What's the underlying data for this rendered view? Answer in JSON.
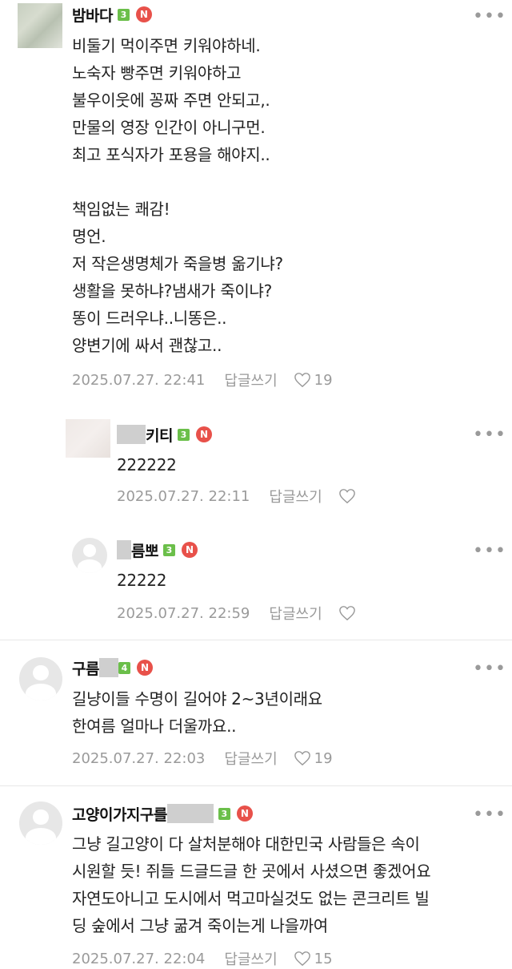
{
  "comments": [
    {
      "nick": "밤바다",
      "level": "3",
      "badge": "N",
      "body": "비둘기 먹이주면 키워야하네.\n노숙자 빵주면 키워야하고\n불우이웃에 꽁짜 주면 안되고,.\n만물의 영장 인간이 아니구먼.\n최고 포식자가 포용을 해야지..\n\n책임없는 쾌감!\n명언.\n저 작은생명체가 죽을병 옮기냐?\n생활을 못하냐?냄새가 죽이냐?\n똥이 드러우냐..니똥은..\n양변기에 싸서 괜찮고..",
      "date": "2025.07.27. 22:41",
      "reply": "답글쓰기",
      "likes": "19"
    },
    {
      "nick": "키티",
      "level": "3",
      "badge": "N",
      "body": "222222",
      "date": "2025.07.27. 22:11",
      "reply": "답글쓰기",
      "likes": ""
    },
    {
      "nick": "름뽀",
      "level": "3",
      "badge": "N",
      "body": "22222",
      "date": "2025.07.27. 22:59",
      "reply": "답글쓰기",
      "likes": ""
    },
    {
      "nick": "구름",
      "level": "4",
      "badge": "N",
      "body": "길냥이들 수명이 길어야 2~3년이래요\n한여름 얼마나 더울까요..",
      "date": "2025.07.27. 22:03",
      "reply": "답글쓰기",
      "likes": "19"
    },
    {
      "nick": "고양이가지구를",
      "level": "3",
      "badge": "N",
      "body": "그냥 길고양이 다 살처분해야 대한민국 사람들은 속이\n시원할 듯! 쥐들 드글드글 한 곳에서 사셨으면 좋겠어요\n자연도아니고 도시에서 먹고마실것도 없는 콘크리트 빌\n딩 숲에서 그냥 굶겨 죽이는게 나을까여",
      "date": "2025.07.27. 22:04",
      "reply": "답글쓰기",
      "likes": "15"
    }
  ],
  "more_icon": "more-horizontal-icon",
  "heart_icon": "heart-outline-icon",
  "colors": {
    "level_badge": "#6bbf4a",
    "new_badge": "#e8514a",
    "meta_text": "#9a9a9a"
  }
}
